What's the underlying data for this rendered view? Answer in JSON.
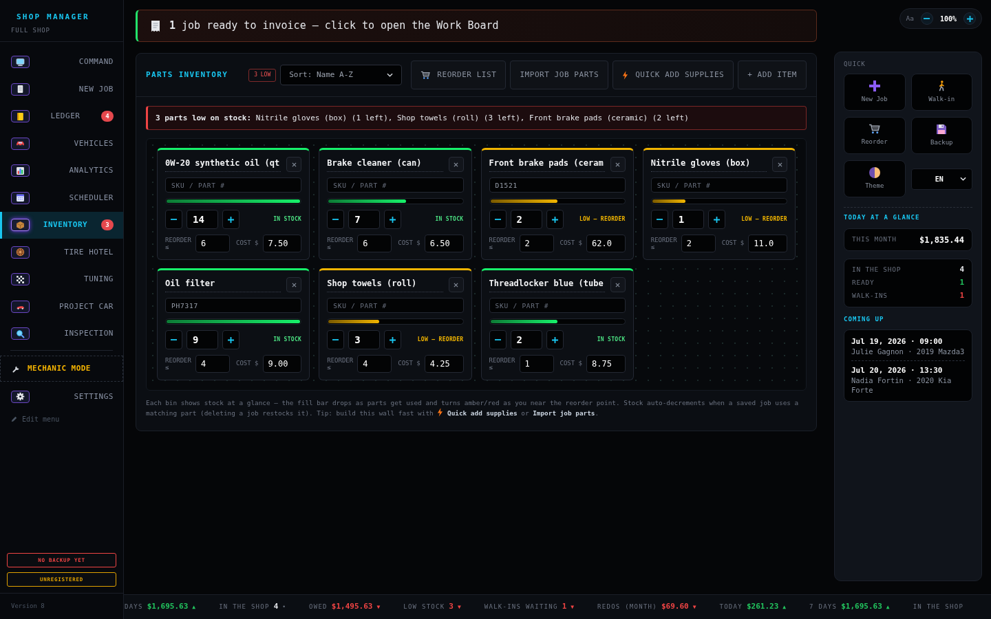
{
  "sidebar": {
    "title": "SHOP MANAGER",
    "subtitle": "FULL SHOP",
    "nav": [
      {
        "label": "COMMAND",
        "selected": false
      },
      {
        "label": "NEW JOB",
        "selected": false
      },
      {
        "label": "LEDGER",
        "selected": false,
        "badge": "4"
      },
      {
        "label": "VEHICLES",
        "selected": false
      },
      {
        "label": "ANALYTICS",
        "selected": false
      },
      {
        "label": "SCHEDULER",
        "selected": false
      },
      {
        "label": "INVENTORY",
        "selected": true,
        "badge": "3"
      },
      {
        "label": "TIRE HOTEL",
        "selected": false
      },
      {
        "label": "TUNING",
        "selected": false
      },
      {
        "label": "PROJECT CAR",
        "selected": false
      },
      {
        "label": "INSPECTION",
        "selected": false
      }
    ],
    "mechanic_mode": {
      "label": "MECHANIC MODE"
    },
    "settings": {
      "label": "SETTINGS",
      "selected": false
    },
    "edit_menu": {
      "label": "Edit menu"
    },
    "status_pills": [
      {
        "label": "NO BACKUP YET",
        "color": "#ef4444"
      },
      {
        "label": "UNREGISTERED",
        "color": "#e0a100"
      }
    ],
    "version": "Version 8"
  },
  "banner": {
    "text": "**1** job ready to invoice — click to open the Work Board"
  },
  "zoom": {
    "label": "Aa",
    "value": "100%"
  },
  "inventory": {
    "title": "PARTS INVENTORY",
    "low_badge": "3 LOW",
    "sort": {
      "value": "Sort: Name A-Z"
    },
    "actions": [
      {
        "label": "REORDER LIST",
        "kind": "reorder"
      },
      {
        "label": "IMPORT JOB PARTS",
        "kind": "import"
      },
      {
        "label": "QUICK ADD SUPPLIES",
        "kind": "supplies"
      },
      {
        "label": "+ ADD ITEM",
        "kind": "add"
      }
    ],
    "alert": "**3 parts low on stock:** Nitrile gloves (box) (1 left), Shop towels (roll) (3 left), Front brake pads (ceramic) (2 left)",
    "bins": [
      {
        "name": "0W-20 synthetic oil (qt",
        "sku": {
          "placeholder": "SKU / PART #"
        },
        "level": 1,
        "low": false,
        "quantity": "14",
        "status": "IN STOCK",
        "reorder_label": "REORDER ≤",
        "reorder": "6",
        "cost_label": "COST $",
        "cost": "7.50"
      },
      {
        "name": "Brake cleaner (can)",
        "sku": {
          "placeholder": "SKU / PART #"
        },
        "level": 0.58,
        "low": false,
        "quantity": "7",
        "status": "IN STOCK",
        "reorder_label": "REORDER ≤",
        "reorder": "6",
        "cost_label": "COST $",
        "cost": "6.50"
      },
      {
        "name": "Front brake pads (ceram",
        "sku": {
          "value": "D1521"
        },
        "level": 0.5,
        "low": true,
        "quantity": "2",
        "status": "LOW — REORDER",
        "reorder_label": "REORDER ≤",
        "reorder": "2",
        "cost_label": "COST $",
        "cost": "62.0"
      },
      {
        "name": "Nitrile gloves (box)",
        "sku": {
          "placeholder": "SKU / PART #"
        },
        "level": 0.25,
        "low": true,
        "quantity": "1",
        "status": "LOW — REORDER",
        "reorder_label": "REORDER ≤",
        "reorder": "2",
        "cost_label": "COST $",
        "cost": "11.0"
      },
      {
        "name": "Oil filter",
        "sku": {
          "value": "PH7317"
        },
        "level": 1,
        "low": false,
        "quantity": "9",
        "status": "IN STOCK",
        "reorder_label": "REORDER ≤",
        "reorder": "4",
        "cost_label": "COST $",
        "cost": "9.00"
      },
      {
        "name": "Shop towels (roll)",
        "sku": {
          "placeholder": "SKU / PART #"
        },
        "level": 0.38,
        "low": true,
        "quantity": "3",
        "status": "LOW — REORDER",
        "reorder_label": "REORDER ≤",
        "reorder": "4",
        "cost_label": "COST $",
        "cost": "4.25"
      },
      {
        "name": "Threadlocker blue (tube",
        "sku": {
          "placeholder": "SKU / PART #"
        },
        "level": 0.5,
        "low": false,
        "quantity": "2",
        "status": "IN STOCK",
        "reorder_label": "REORDER ≤",
        "reorder": "1",
        "cost_label": "COST $",
        "cost": "8.75"
      }
    ],
    "note": [
      "Each bin shows stock at a glance — the fill bar drops as parts get used and turns amber/red as you near the reorder point. Stock auto-decrements when a saved job uses a matching part (deleting a job restocks it). Tip: build this wall fast with",
      "**Quick add supplies** or **Import job parts**."
    ]
  },
  "quick_panel": {
    "title": "QUICK",
    "tiles": [
      {
        "label": "New Job"
      },
      {
        "label": "Walk-in"
      },
      {
        "label": "Reorder"
      },
      {
        "label": "Backup"
      },
      {
        "label": "Theme"
      }
    ],
    "language": {
      "value": "EN"
    },
    "glance_title": "TODAY AT A GLANCE",
    "month": {
      "label": "THIS MONTH",
      "value": "$1,835.44"
    },
    "stats": [
      {
        "label": "IN THE SHOP",
        "value": "4",
        "color": "#e5e7eb"
      },
      {
        "label": "READY",
        "value": "1",
        "color": "#22c55e"
      },
      {
        "label": "WALK-INS",
        "value": "1",
        "color": "#ef4444"
      }
    ],
    "coming_title": "COMING UP",
    "appointments": [
      {
        "when": "Jul 19, 2026 · 09:00",
        "who": "Julie Gagnon · 2019 Mazda3"
      },
      {
        "when": "Jul 20, 2026 · 13:30",
        "who": "Nadia Fortin · 2020 Kia Forte"
      }
    ]
  },
  "ticker": {
    "items": [
      {
        "label": "DAYS",
        "value": "$1,695.63",
        "arrow": "▲",
        "kind": "up"
      },
      {
        "label": "IN THE SHOP",
        "value": "4",
        "arrow": "•",
        "kind": "flat"
      },
      {
        "label": "OWED",
        "value": "$1,495.63",
        "arrow": "▼",
        "kind": "down"
      },
      {
        "label": "LOW STOCK",
        "value": "3",
        "arrow": "▼",
        "kind": "down"
      },
      {
        "label": "WALK-INS WAITING",
        "value": "1",
        "arrow": "▼",
        "kind": "down"
      },
      {
        "label": "REDOS (MONTH)",
        "value": "$69.60",
        "arrow": "▼",
        "kind": "down"
      },
      {
        "label": "TODAY",
        "value": "$261.23",
        "arrow": "▲",
        "kind": "up"
      },
      {
        "label": "7 DAYS",
        "value": "$1,695.63",
        "arrow": "▲",
        "kind": "up"
      },
      {
        "label": "IN THE SHOP"
      }
    ]
  }
}
